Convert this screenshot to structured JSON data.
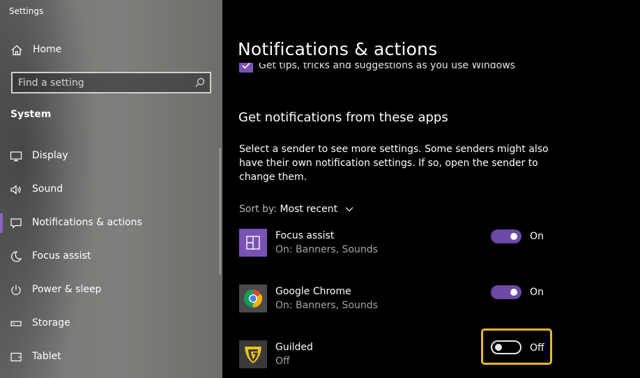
{
  "window": {
    "title": "Settings"
  },
  "sidebar": {
    "home_label": "Home",
    "search": {
      "placeholder": "Find a setting"
    },
    "section_title": "System",
    "items": [
      {
        "label": "Display",
        "icon": "display-icon"
      },
      {
        "label": "Sound",
        "icon": "speaker-icon"
      },
      {
        "label": "Notifications & actions",
        "icon": "notification-icon",
        "active": true
      },
      {
        "label": "Focus assist",
        "icon": "moon-icon"
      },
      {
        "label": "Power & sleep",
        "icon": "power-icon"
      },
      {
        "label": "Storage",
        "icon": "storage-icon"
      },
      {
        "label": "Tablet",
        "icon": "tablet-icon"
      }
    ]
  },
  "main": {
    "title": "Notifications & actions",
    "tips_checkbox_label": "Get tips, tricks and suggestions as you use Windows",
    "section_heading": "Get notifications from these apps",
    "description": "Select a sender to see more settings. Some senders might also have their own notification settings. If so, open the sender to change them.",
    "sort": {
      "label": "Sort by:",
      "value": "Most recent"
    },
    "apps": [
      {
        "name": "Focus assist",
        "status": "On: Banners, Sounds",
        "toggle": "On",
        "icon": "focus-assist-icon"
      },
      {
        "name": "Google Chrome",
        "status": "On: Banners, Sounds",
        "toggle": "On",
        "icon": "chrome-icon"
      },
      {
        "name": "Guilded",
        "status": "Off",
        "toggle": "Off",
        "icon": "guilded-icon"
      }
    ]
  },
  "colors": {
    "accent": "#6c49a6",
    "highlight": "#e7bb1d",
    "guilded_yellow": "#f5c400",
    "focus_tile": "#7a52b3"
  }
}
